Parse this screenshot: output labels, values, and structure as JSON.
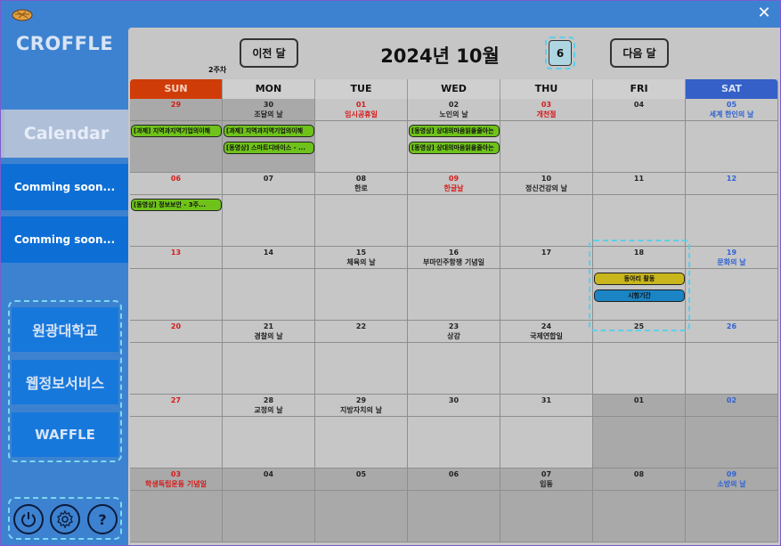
{
  "app": {
    "brand": "CROFFLE"
  },
  "sidebar": {
    "calendar_label": "Calendar",
    "soon1": "Comming soon...",
    "soon2": "Comming soon...",
    "links": [
      "원광대학교",
      "웹정보서비스",
      "WAFFLE"
    ],
    "icons": [
      "power-icon",
      "gear-icon",
      "help-icon"
    ],
    "help_glyph": "?"
  },
  "header": {
    "prev": "이전 달",
    "next": "다음 달",
    "title": "2024년 10월",
    "week_count": "6",
    "week_label": "2주차"
  },
  "days_of_week": [
    "SUN",
    "MON",
    "TUE",
    "WED",
    "THU",
    "FRI",
    "SAT"
  ],
  "weeks": [
    [
      {
        "d": "29",
        "h": "",
        "c": "red",
        "other": true
      },
      {
        "d": "30",
        "h": "조달의 날",
        "c": "",
        "other": true
      },
      {
        "d": "01",
        "h": "임시공휴일",
        "c": "red",
        "other": false
      },
      {
        "d": "02",
        "h": "노인의 날",
        "c": "",
        "other": false
      },
      {
        "d": "03",
        "h": "개천절",
        "c": "red",
        "other": false
      },
      {
        "d": "04",
        "h": "",
        "c": "",
        "other": false
      },
      {
        "d": "05",
        "h": "세계 한인의 날",
        "c": "blue",
        "other": false
      }
    ],
    [
      {
        "d": "06",
        "h": "",
        "c": "red",
        "other": false
      },
      {
        "d": "07",
        "h": "",
        "c": "",
        "other": false
      },
      {
        "d": "08",
        "h": "한로",
        "c": "",
        "other": false
      },
      {
        "d": "09",
        "h": "한글날",
        "c": "red",
        "other": false
      },
      {
        "d": "10",
        "h": "정신건강의 날",
        "c": "",
        "other": false
      },
      {
        "d": "11",
        "h": "",
        "c": "",
        "other": false
      },
      {
        "d": "12",
        "h": "",
        "c": "blue",
        "other": false
      }
    ],
    [
      {
        "d": "13",
        "h": "",
        "c": "red",
        "other": false
      },
      {
        "d": "14",
        "h": "",
        "c": "",
        "other": false
      },
      {
        "d": "15",
        "h": "체육의 날",
        "c": "",
        "other": false
      },
      {
        "d": "16",
        "h": "부마민주항쟁 기념일",
        "c": "",
        "other": false
      },
      {
        "d": "17",
        "h": "",
        "c": "",
        "other": false
      },
      {
        "d": "18",
        "h": "",
        "c": "",
        "other": false
      },
      {
        "d": "19",
        "h": "문화의 날",
        "c": "blue",
        "other": false
      }
    ],
    [
      {
        "d": "20",
        "h": "",
        "c": "red",
        "other": false
      },
      {
        "d": "21",
        "h": "경찰의 날",
        "c": "",
        "other": false
      },
      {
        "d": "22",
        "h": "",
        "c": "",
        "other": false
      },
      {
        "d": "23",
        "h": "상강",
        "c": "",
        "other": false
      },
      {
        "d": "24",
        "h": "국제연합일",
        "c": "",
        "other": false
      },
      {
        "d": "25",
        "h": "",
        "c": "",
        "other": false
      },
      {
        "d": "26",
        "h": "",
        "c": "blue",
        "other": false
      }
    ],
    [
      {
        "d": "27",
        "h": "",
        "c": "red",
        "other": false
      },
      {
        "d": "28",
        "h": "교정의 날",
        "c": "",
        "other": false
      },
      {
        "d": "29",
        "h": "지방자치의 날",
        "c": "",
        "other": false
      },
      {
        "d": "30",
        "h": "",
        "c": "",
        "other": false
      },
      {
        "d": "31",
        "h": "",
        "c": "",
        "other": false
      },
      {
        "d": "01",
        "h": "",
        "c": "",
        "other": true
      },
      {
        "d": "02",
        "h": "",
        "c": "blue",
        "other": true
      }
    ],
    [
      {
        "d": "03",
        "h": "학생독립운동 기념일",
        "c": "red",
        "other": true
      },
      {
        "d": "04",
        "h": "",
        "c": "",
        "other": true
      },
      {
        "d": "05",
        "h": "",
        "c": "",
        "other": true
      },
      {
        "d": "06",
        "h": "",
        "c": "",
        "other": true
      },
      {
        "d": "07",
        "h": "입동",
        "c": "",
        "other": true
      },
      {
        "d": "08",
        "h": "",
        "c": "",
        "other": true
      },
      {
        "d": "09",
        "h": "소방의 날",
        "c": "blue",
        "other": true
      }
    ]
  ],
  "events": [
    {
      "w": 0,
      "col": 0,
      "slot": 0,
      "text": "[과제] 지역과지역기업의이해",
      "color": "green"
    },
    {
      "w": 0,
      "col": 1,
      "slot": 0,
      "text": "[과제] 지역과지역기업의이해",
      "color": "green"
    },
    {
      "w": 0,
      "col": 1,
      "slot": 1,
      "text": "[동영상] 스마트디바이스 - ...",
      "color": "green"
    },
    {
      "w": 0,
      "col": 3,
      "slot": 0,
      "text": "[동영상] 상대의마음읽을줄아는",
      "color": "green"
    },
    {
      "w": 0,
      "col": 3,
      "slot": 1,
      "text": "[동영상] 상대의마음읽을줄아는",
      "color": "green"
    },
    {
      "w": 1,
      "col": 0,
      "slot": 0,
      "text": "[동영상] 정보보안 - 3주...",
      "color": "green"
    },
    {
      "w": 2,
      "col": 5,
      "slot": 0,
      "text": "동아리 활동",
      "color": "yellow"
    },
    {
      "w": 2,
      "col": 5,
      "slot": 1,
      "text": "시험기간",
      "color": "blue"
    }
  ]
}
